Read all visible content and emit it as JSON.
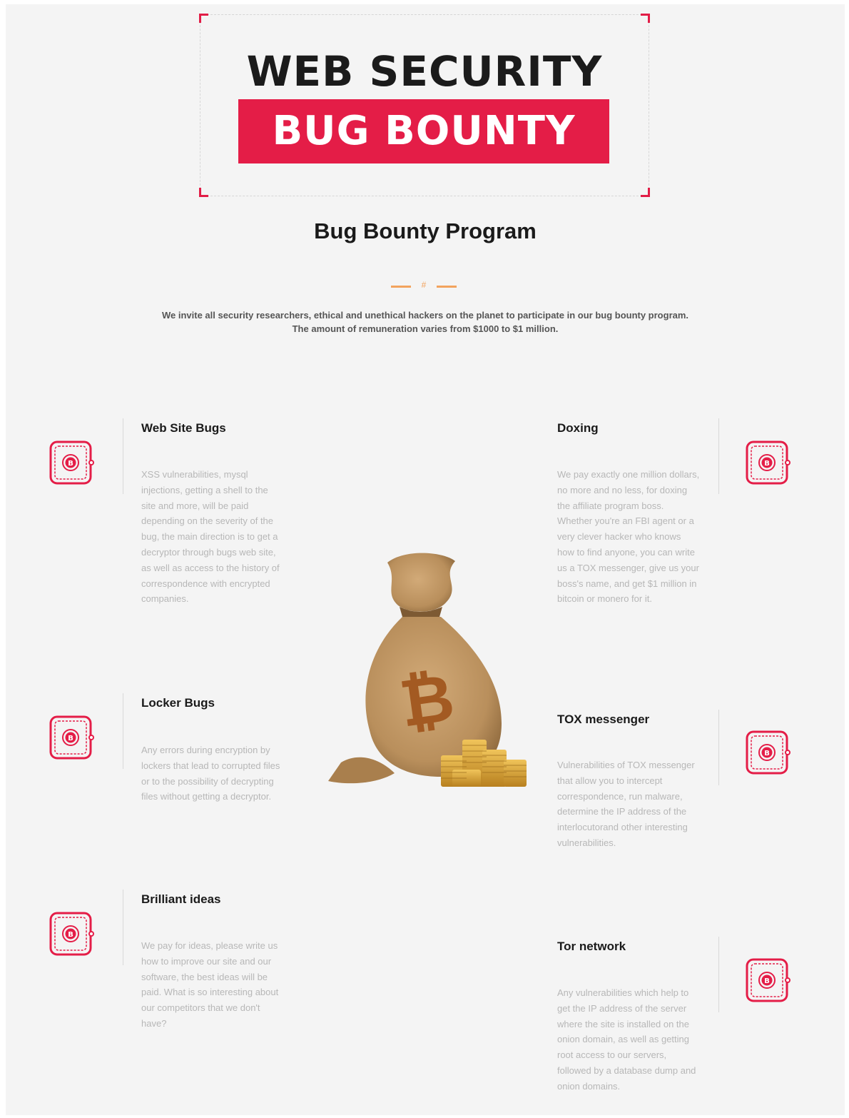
{
  "hero": {
    "line1": "WEB SECURITY",
    "line2": "BUG BOUNTY"
  },
  "program": {
    "title": "Bug Bounty Program",
    "divider_glyph": "#",
    "intro_line1": "We invite all security researchers, ethical and unethical hackers on the planet to participate in our bug bounty program.",
    "intro_line2": "The amount of remuneration varies from $1000 to $1 million."
  },
  "features": {
    "web_site_bugs": {
      "title": "Web Site Bugs",
      "desc": "XSS vulnerabilities, mysql injections, getting a shell to the site and more, will be paid depending on the severity of the bug, the main direction is to get a decryptor through bugs web site, as well as access to the history of correspondence with encrypted companies."
    },
    "locker_bugs": {
      "title": "Locker Bugs",
      "desc": "Any errors during encryption by lockers that lead to corrupted files or to the possibility of decrypting files without getting a decryptor."
    },
    "brilliant_ideas": {
      "title": "Brilliant ideas",
      "desc": "We pay for ideas, please write us how to improve our site and our software, the best ideas will be paid. What is so interesting about our competitors that we don't have?"
    },
    "doxing": {
      "title": "Doxing",
      "desc": "We pay exactly one million dollars, no more and no less, for doxing the affiliate program boss. Whether you're an FBI agent or a very clever hacker who knows how to find anyone, you can write us a TOX messenger, give us your boss's name, and get $1 million in bitcoin or monero for it."
    },
    "tox_messenger": {
      "title": "TOX messenger",
      "desc": "Vulnerabilities of TOX messenger that allow you to intercept correspondence, run malware, determine the IP address of the interlocutorand other interesting vulnerabilities."
    },
    "tor_network": {
      "title": "Tor network",
      "desc": "Any vulnerabilities which help to get the IP address of the server where the site is installed on the onion domain, as well as getting root access to our servers, followed by a database dump and onion domains."
    }
  },
  "icons": {
    "feature_icon": "bitcoin-wallet-icon",
    "center_image": "bitcoin-money-bag"
  },
  "colors": {
    "accent": "#e41d47",
    "divider": "#f2a35e",
    "bag": "#b98f5c",
    "coins": "#d9a23a"
  }
}
